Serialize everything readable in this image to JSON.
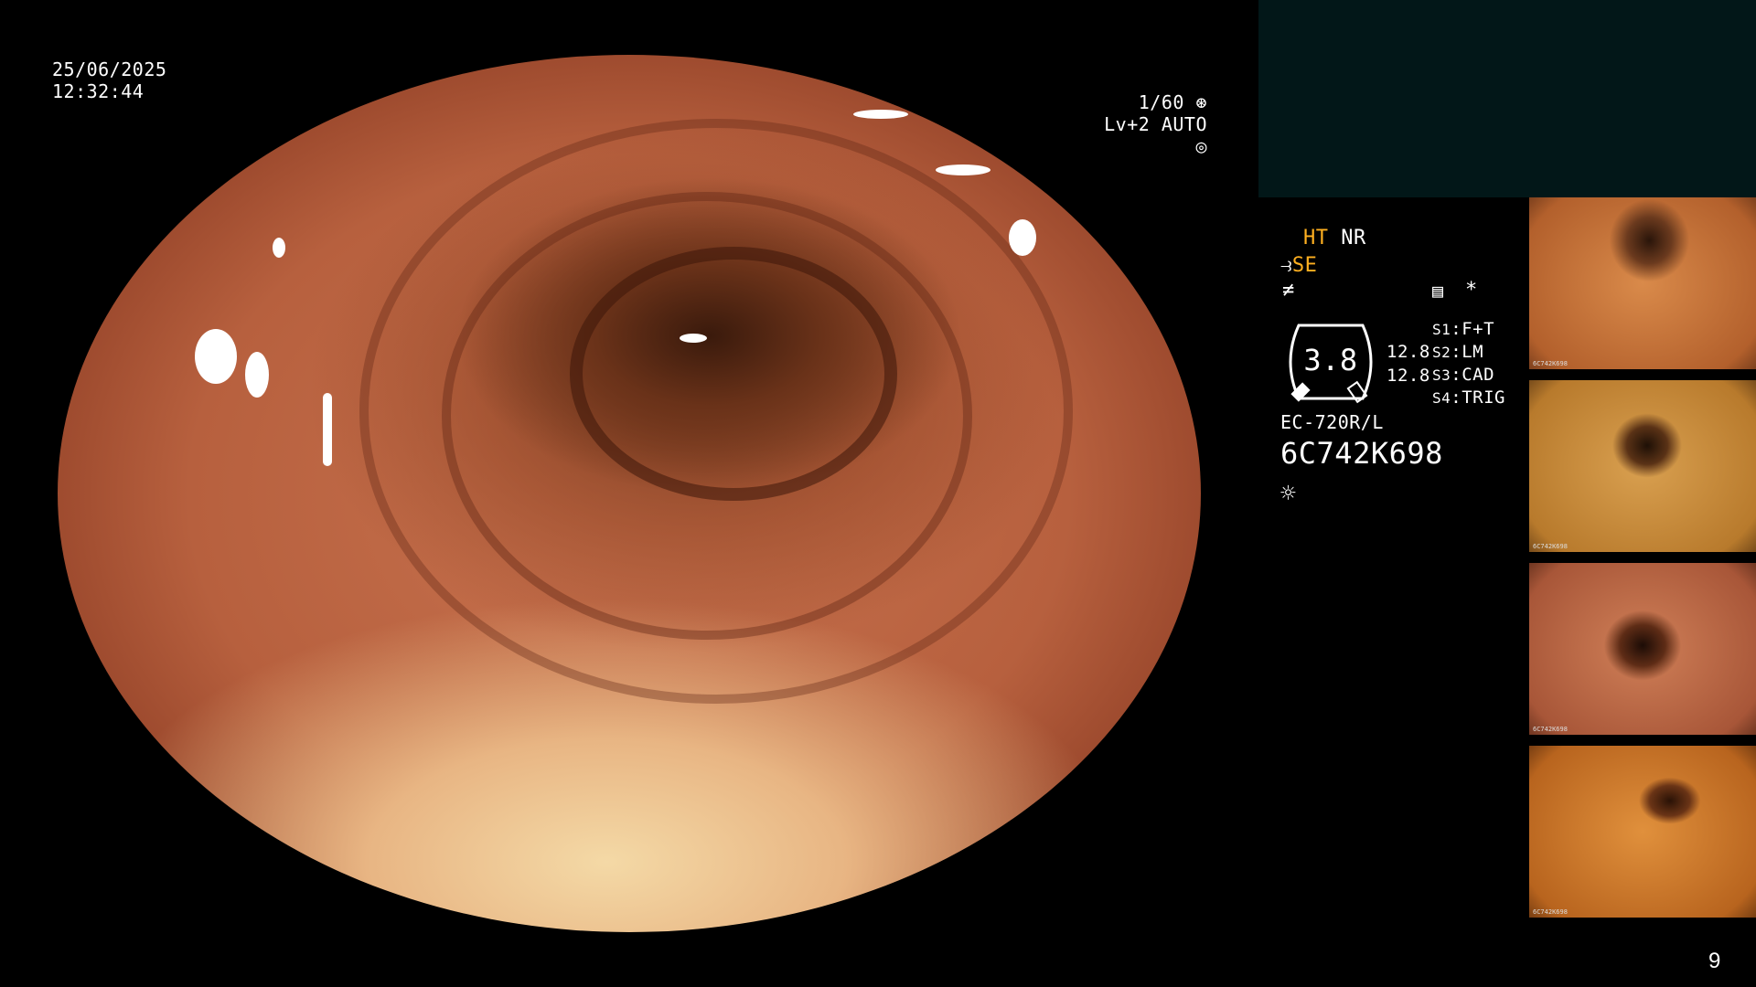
{
  "overlay": {
    "date": "25/06/2025",
    "time": "12:32:44",
    "shutter": "1/60",
    "shutter_icon": "aperture-icon",
    "level": "Lv+2",
    "mode": "AUTO",
    "mode_icon": "iris-icon"
  },
  "status": {
    "ht": "HT",
    "nr": "NR",
    "se": "SE",
    "gauge_value": "3.8",
    "value_a": "12.8",
    "value_b": "12.8",
    "scope_model": "EC-720R/L",
    "serial": "6C742K698",
    "settings": [
      {
        "key": "S1",
        "value": "F+T"
      },
      {
        "key": "S2",
        "value": "LM"
      },
      {
        "key": "S3",
        "value": "CAD"
      },
      {
        "key": "S4",
        "value": "TRIG"
      }
    ],
    "asterisk": "*"
  },
  "thumbnails": [
    {
      "label": "6C742K698"
    },
    {
      "label": "6C742K698"
    },
    {
      "label": "6C742K698"
    },
    {
      "label": "6C742K698"
    }
  ],
  "page_number": "9",
  "colors": {
    "accent_yellow": "#ffb020",
    "panel_dark": "#021718"
  }
}
